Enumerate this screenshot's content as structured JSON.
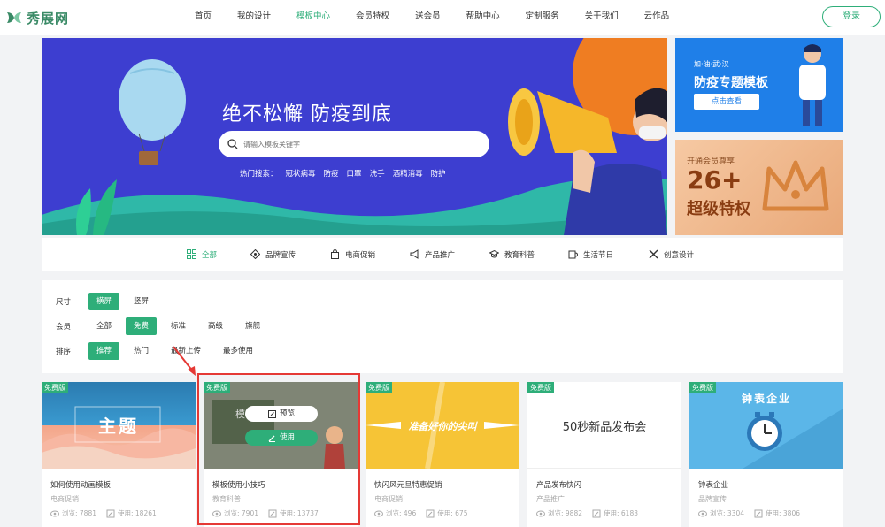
{
  "header": {
    "brand": "秀展网",
    "nav": [
      "首页",
      "我的设计",
      "模板中心",
      "会员特权",
      "送会员",
      "帮助中心",
      "定制服务",
      "关于我们",
      "云作品"
    ],
    "active_nav": "模板中心",
    "login": "登录"
  },
  "hero": {
    "title": "绝不松懈  防疫到底",
    "search_placeholder": "请输入模板关键字",
    "hot_label": "热门搜索：",
    "hot_tags": [
      "冠状病毒",
      "防疫",
      "口罩",
      "洗手",
      "酒精消毒",
      "防护"
    ]
  },
  "side_banners": {
    "top": {
      "tagline": "加·油·武·汉",
      "title": "防疫专题模板",
      "button": "点击查看"
    },
    "bottom": {
      "tagline": "开通会员尊享",
      "big": "26+",
      "title": "超级特权"
    }
  },
  "categories": [
    {
      "label": "全部",
      "icon": "grid-icon"
    },
    {
      "label": "品牌宣传",
      "icon": "brand-icon"
    },
    {
      "label": "电商促销",
      "icon": "shopping-bag-icon"
    },
    {
      "label": "产品推广",
      "icon": "megaphone-icon"
    },
    {
      "label": "教育科普",
      "icon": "graduation-cap-icon"
    },
    {
      "label": "生活节日",
      "icon": "cup-icon"
    },
    {
      "label": "创意设计",
      "icon": "tools-icon"
    }
  ],
  "filters": {
    "size": {
      "label": "尺寸",
      "options": [
        "横屏",
        "竖屏"
      ],
      "selected": "横屏"
    },
    "member": {
      "label": "会员",
      "options": [
        "全部",
        "免费",
        "标准",
        "高级",
        "旗舰"
      ],
      "selected": "免费"
    },
    "sort": {
      "label": "排序",
      "options": [
        "推荐",
        "热门",
        "最新上传",
        "最多使用"
      ],
      "selected": "推荐"
    }
  },
  "cards": [
    {
      "badge": "免费版",
      "title": "如何使用动画模板",
      "category": "电商促销",
      "views_label": "浏览: 7881",
      "uses_label": "使用: 18261",
      "thumb_text": "主题"
    },
    {
      "badge": "免费版",
      "title": "模板使用小技巧",
      "category": "教育科普",
      "views_label": "浏览: 7901",
      "uses_label": "使用: 13737",
      "thumb_text": "模板",
      "preview": "预览",
      "use": "使用"
    },
    {
      "badge": "免费版",
      "title": "快闪风元旦特惠促销",
      "category": "电商促销",
      "views_label": "浏览: 496",
      "uses_label": "使用: 675",
      "thumb_text": "准备好你的尖叫"
    },
    {
      "badge": "免费版",
      "title": "产品发布快闪",
      "category": "产品推广",
      "views_label": "浏览: 9882",
      "uses_label": "使用: 6183",
      "thumb_text": "50秒新品发布会"
    },
    {
      "badge": "免费版",
      "title": "钟表企业",
      "category": "品牌宣传",
      "views_label": "浏览: 3304",
      "uses_label": "使用: 3806",
      "thumb_text": "钟表企业"
    }
  ],
  "colors": {
    "accent": "#2eae79",
    "hero_bg": "#3d3ed0",
    "highlight": "#e53935"
  }
}
